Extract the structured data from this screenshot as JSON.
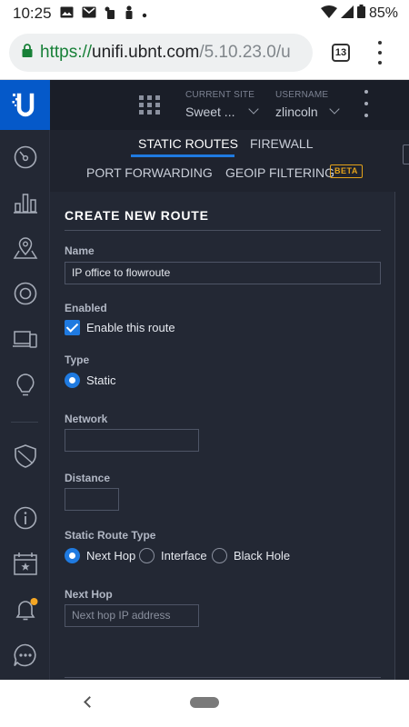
{
  "status_bar": {
    "time": "10:25",
    "battery": "85%",
    "icons": [
      "image-icon",
      "gmail-icon",
      "mobile-data-icon",
      "person-icon",
      "dot-icon"
    ]
  },
  "browser": {
    "url_scheme": "https://",
    "url_host": "unifi.ubnt.com",
    "url_path": "/5.10.23.0/u",
    "tab_count": "13"
  },
  "header": {
    "current_site_label": "CURRENT SITE",
    "current_site_value": "Sweet ...",
    "username_label": "USERNAME",
    "username_value": "zlincoln"
  },
  "sidebar": {
    "items": [
      {
        "icon": "dashboard-icon"
      },
      {
        "icon": "statistics-icon"
      },
      {
        "icon": "map-icon"
      },
      {
        "icon": "devices-icon"
      },
      {
        "icon": "clients-icon"
      },
      {
        "icon": "insights-icon"
      },
      {
        "icon": "security-shield-icon"
      },
      {
        "icon": "info-icon"
      },
      {
        "icon": "calendar-events-icon"
      },
      {
        "icon": "alerts-bell-icon"
      },
      {
        "icon": "chat-icon"
      }
    ]
  },
  "tabs": {
    "row1": [
      "STATIC ROUTES",
      "FIREWALL"
    ],
    "row2": [
      "PORT FORWARDING",
      "GEOIP FILTERING"
    ],
    "active": "STATIC ROUTES",
    "beta_label": "BETA"
  },
  "form": {
    "title": "CREATE NEW ROUTE",
    "name_label": "Name",
    "name_value": "IP office to flowroute",
    "enabled_label": "Enabled",
    "enabled_option": "Enable this route",
    "enabled_checked": true,
    "type_label": "Type",
    "type_option": "Static",
    "network_label": "Network",
    "network_value": "",
    "distance_label": "Distance",
    "distance_value": "",
    "route_type_label": "Static Route Type",
    "route_type_options": [
      "Next Hop",
      "Interface",
      "Black Hole"
    ],
    "route_type_selected": "Next Hop",
    "next_hop_label": "Next Hop",
    "next_hop_placeholder": "Next hop IP address"
  },
  "colors": {
    "accent": "#1f7ae0",
    "brand": "#0559c9",
    "beta": "#e3a21a",
    "notification_dot": "#f5a623"
  }
}
